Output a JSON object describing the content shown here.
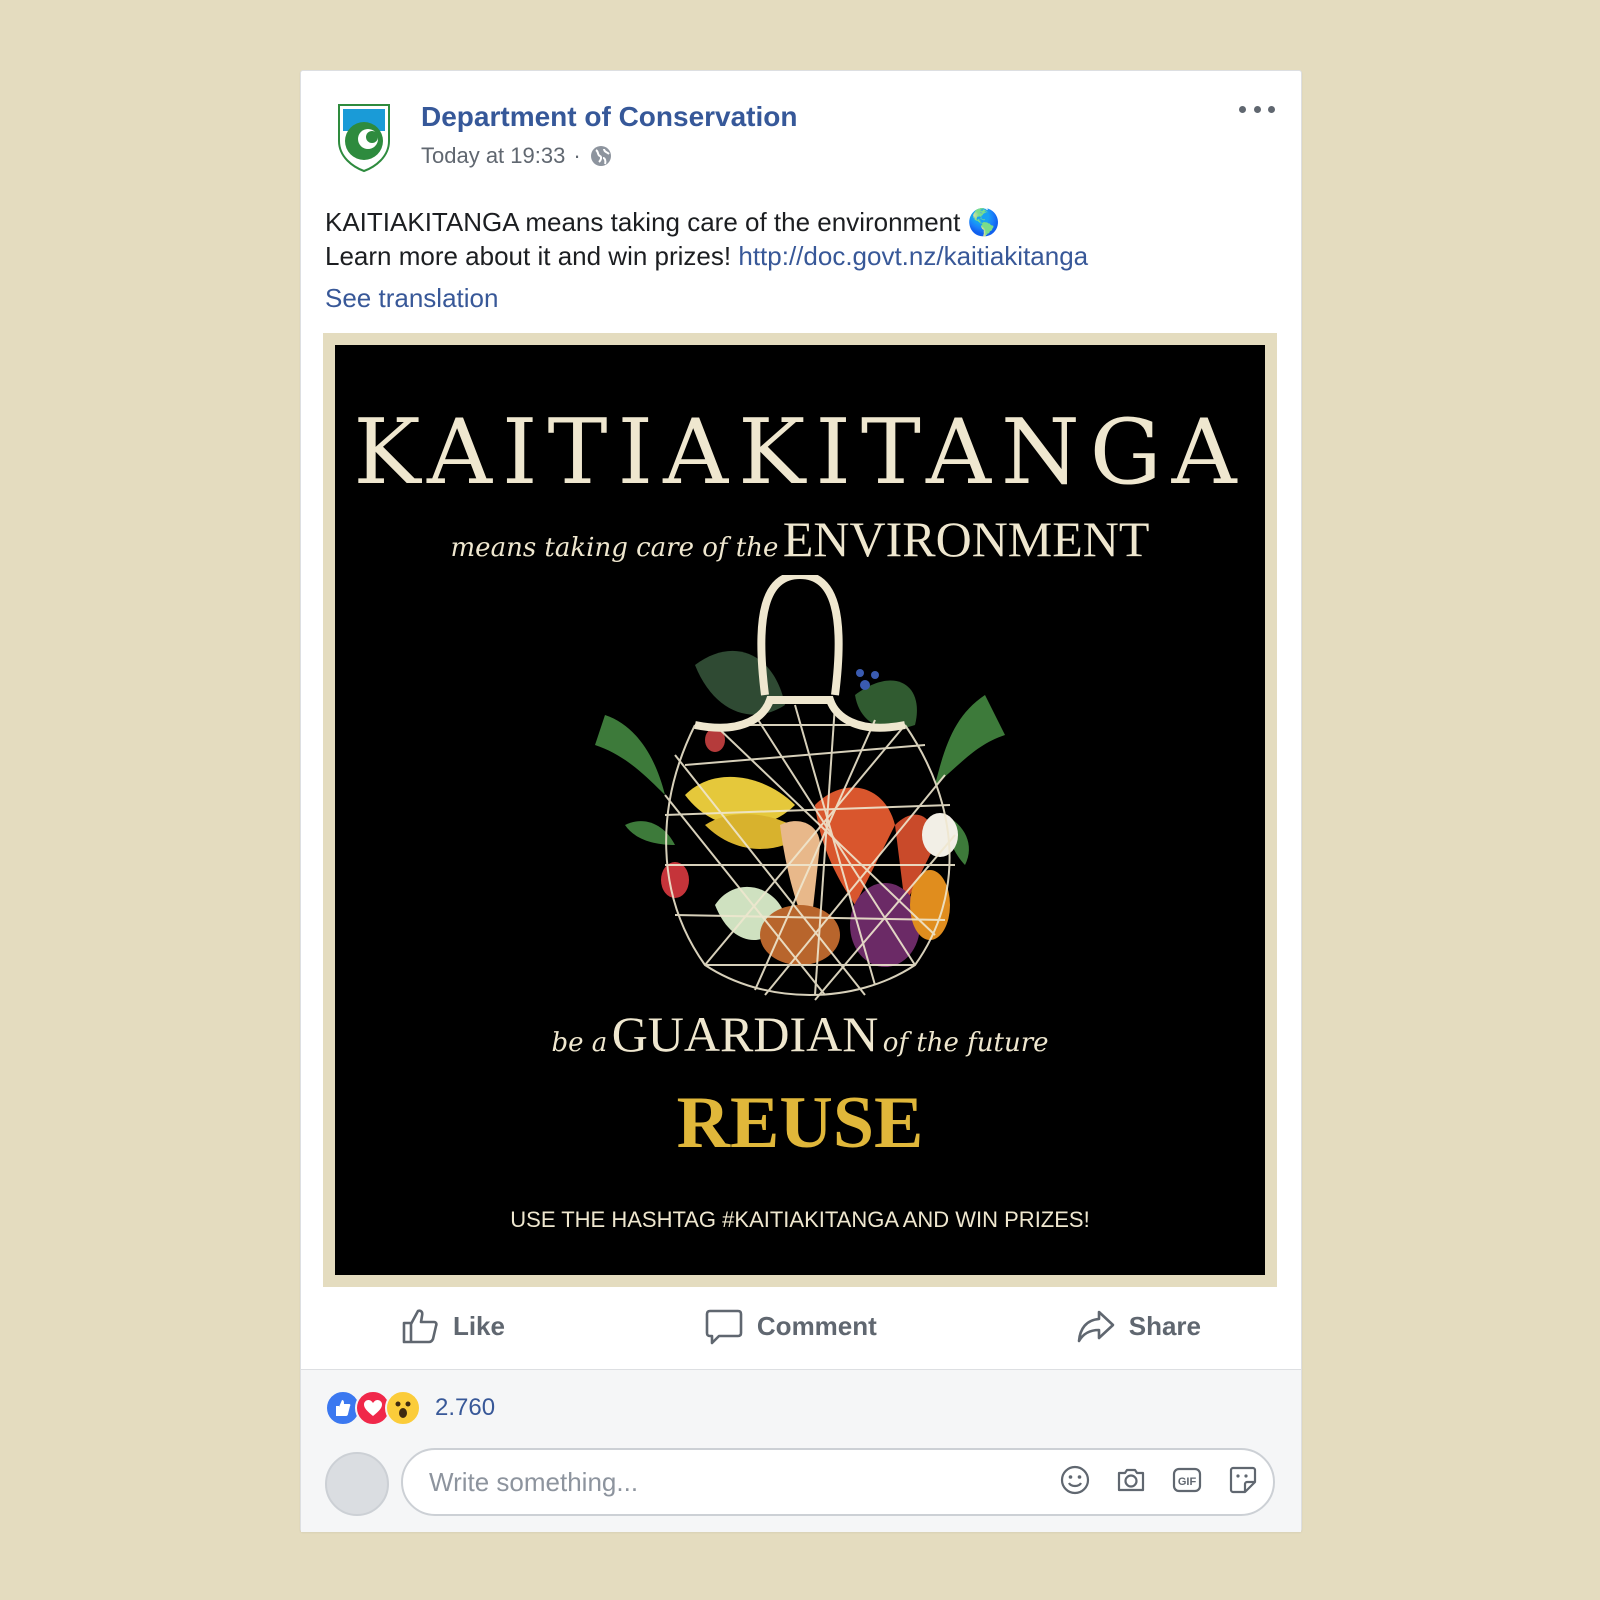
{
  "post": {
    "page_name": "Department of Conservation",
    "timestamp": "Today at 19:33",
    "separator": "·",
    "privacy_icon": "globe-icon",
    "more_icon": "more-horizontal-icon",
    "text_line1": "KAITIAKITANGA means taking care of the environment",
    "text_emoji": "🌎",
    "text_line2": "Learn more about it and win prizes!",
    "link": "http://doc.govt.nz/kaitiakitanga",
    "see_translation": "See translation"
  },
  "image": {
    "title": "KAITIAKITANGA",
    "line1_script": "means taking care of the",
    "line1_caps": "ENVIRONMENT",
    "line2_script_a": "be a",
    "line2_caps": "GUARDIAN",
    "line2_script_b": "of the future",
    "reuse": "REUSE",
    "hashtag": "USE THE HASHTAG #KAITIAKITANGA AND WIN PRIZES!",
    "colors": {
      "background": "#000000",
      "text": "#efe7cf",
      "accent": "#e0b73a"
    }
  },
  "actions": {
    "like": "Like",
    "comment": "Comment",
    "share": "Share"
  },
  "reactions": {
    "icons": [
      "like-reaction-icon",
      "love-reaction-icon",
      "wow-reaction-icon"
    ],
    "count": "2.760"
  },
  "composer": {
    "placeholder": "Write something...",
    "icons": [
      "emoji-icon",
      "camera-icon",
      "gif-icon",
      "sticker-icon"
    ]
  },
  "colors": {
    "page_background": "#e4dcbf",
    "link_blue": "#385898",
    "name_blue": "#365899",
    "muted_text": "#606770"
  }
}
